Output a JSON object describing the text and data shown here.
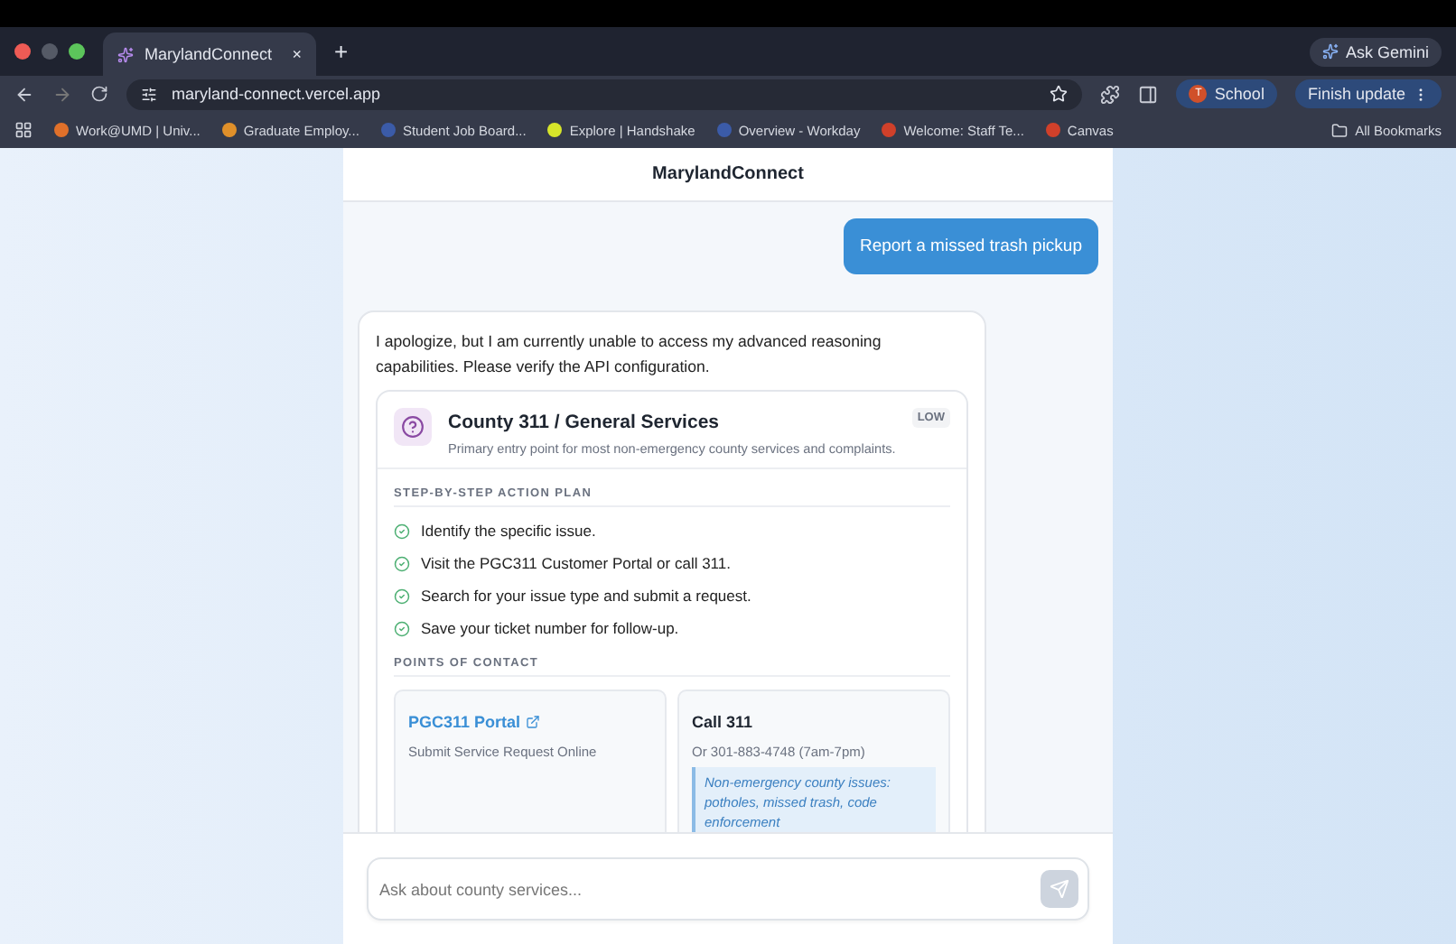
{
  "browser": {
    "tab": {
      "title": "MarylandConnect",
      "close": "×",
      "new_tab": "+"
    },
    "ask_button": "Ask Gemini",
    "address": "maryland-connect.vercel.app",
    "profile": {
      "initial": "T",
      "label": "School"
    },
    "update_button": "Finish update",
    "bookmarks": [
      {
        "label": "Work@UMD | Univ...",
        "color": "#e0702a"
      },
      {
        "label": "Graduate Employ...",
        "color": "#e0902a"
      },
      {
        "label": "Student Job Board...",
        "color": "#3b5ba8"
      },
      {
        "label": "Explore | Handshake",
        "color": "#d7e52a"
      },
      {
        "label": "Overview - Workday",
        "color": "#3b5ba8"
      },
      {
        "label": "Welcome: Staff Te...",
        "color": "#d0402a"
      },
      {
        "label": "Canvas",
        "color": "#d0402a"
      }
    ],
    "all_bookmarks": "All Bookmarks"
  },
  "app": {
    "title": "MarylandConnect",
    "messages": [
      {
        "kind": "user",
        "text": "Report a missed trash pickup"
      },
      {
        "kind": "assistant",
        "text": "I apologize, but I am currently unable to access my advanced reasoning capabilities. Please verify the API configuration.",
        "card": {
          "title": "County 311 / General Services",
          "priority": "LOW",
          "description": "Primary entry point for most non-emergency county services and complaints.",
          "plan_heading": "STEP-BY-STEP ACTION PLAN",
          "steps": [
            "Identify the specific issue.",
            "Visit the PGC311 Customer Portal or call 311.",
            "Search for your issue type and submit a request.",
            "Save your ticket number for follow-up."
          ],
          "contacts_heading": "POINTS OF CONTACT",
          "contacts": [
            {
              "kind": "link",
              "name": "PGC311 Portal",
              "detail": "Submit Service Request Online"
            },
            {
              "kind": "phone",
              "name": "Call 311",
              "detail": "Or 301-883-4748 (7am-7pm)",
              "note": "Non-emergency county issues: potholes, missed trash, code enforcement"
            }
          ]
        }
      }
    ],
    "input": {
      "placeholder": "Ask about county services..."
    }
  }
}
